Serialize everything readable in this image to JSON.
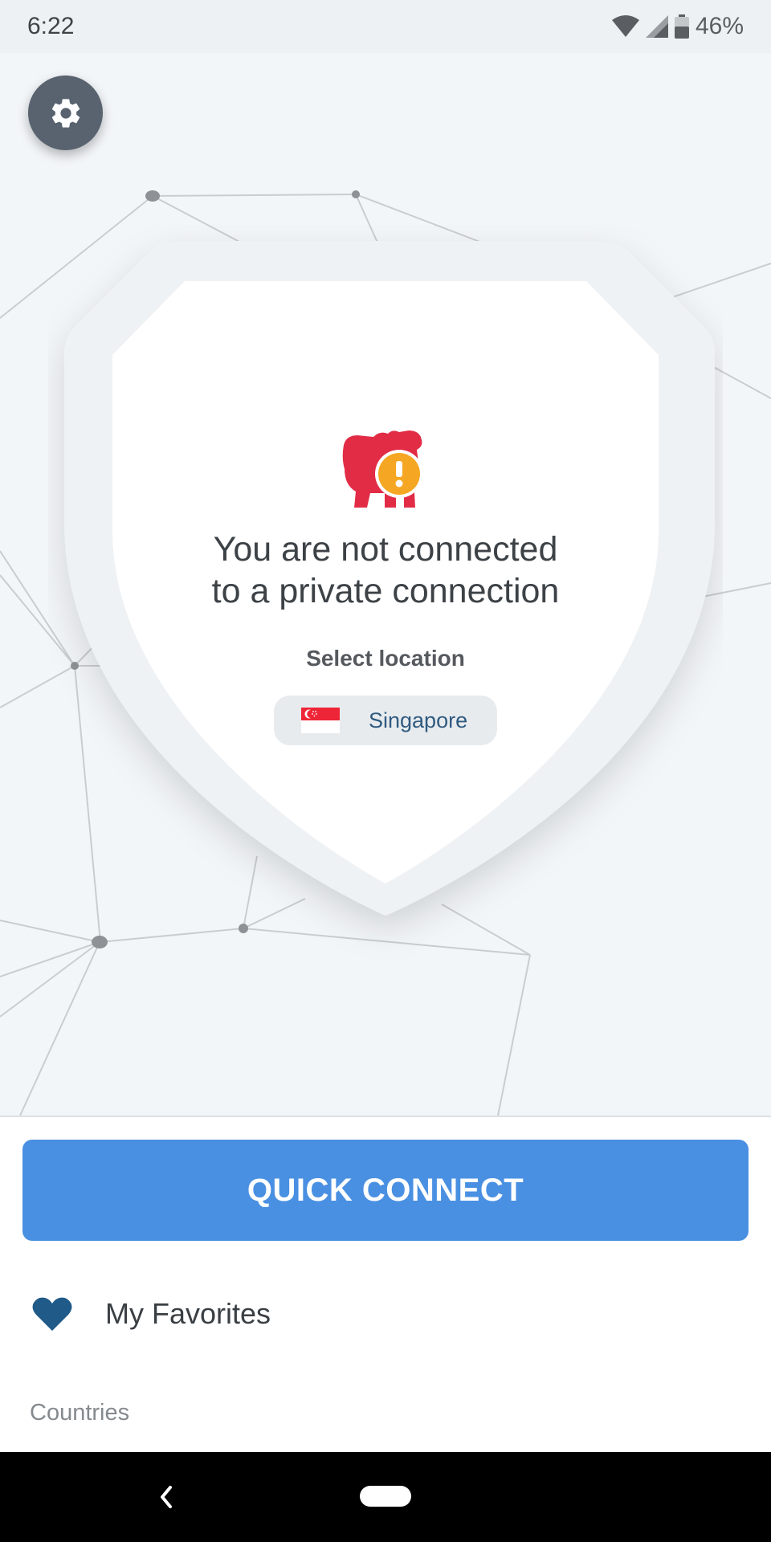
{
  "status_bar": {
    "time": "6:22",
    "battery": "46%",
    "icons": [
      "wifi-icon",
      "cell-signal-icon",
      "battery-icon"
    ]
  },
  "settings": {
    "icon": "gear-icon"
  },
  "main": {
    "logo": "bulldog-warning-icon",
    "headline_line1": "You are not connected",
    "headline_line2": "to a private connection",
    "select_label": "Select location",
    "location": {
      "name": "Singapore",
      "flag": "singapore-flag-icon"
    }
  },
  "actions": {
    "quick_connect_label": "QUICK CONNECT"
  },
  "list": {
    "favorites_label": "My Favorites",
    "favorites_icon": "heart-icon",
    "section_label": "Countries"
  },
  "colors": {
    "accent": "#4a90e2",
    "brand_red": "#e22c46",
    "warning": "#f5a623",
    "heart": "#1f5a88"
  }
}
